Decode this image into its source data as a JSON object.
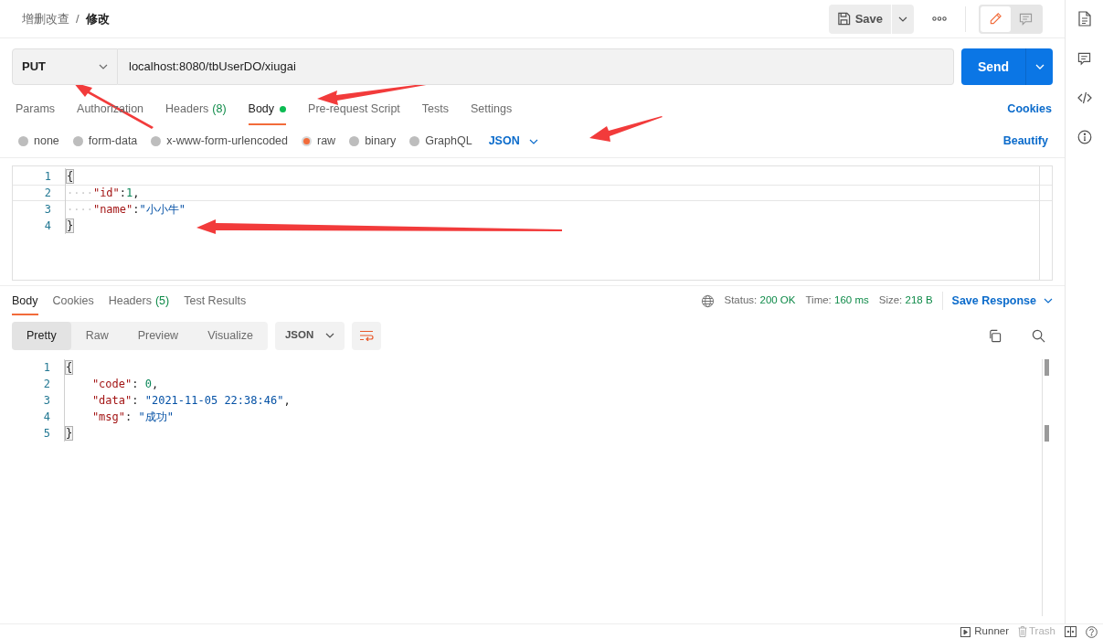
{
  "breadcrumb": {
    "parent": "增删改查",
    "separator": "/",
    "current": "修改"
  },
  "header_actions": {
    "save": "Save",
    "edit_mode_selected": true
  },
  "request": {
    "method": "PUT",
    "url": "localhost:8080/tbUserDO/xiugai",
    "send": "Send"
  },
  "request_tabs": [
    {
      "label": "Params",
      "selected": false
    },
    {
      "label": "Authorization",
      "selected": false
    },
    {
      "label": "Headers",
      "count": "(8)",
      "selected": false
    },
    {
      "label": "Body",
      "dot": true,
      "selected": true
    },
    {
      "label": "Pre-request Script",
      "selected": false
    },
    {
      "label": "Tests",
      "selected": false
    },
    {
      "label": "Settings",
      "selected": false
    }
  ],
  "cookies_link": "Cookies",
  "body_types": [
    {
      "label": "none",
      "selected": false
    },
    {
      "label": "form-data",
      "selected": false
    },
    {
      "label": "x-www-form-urlencoded",
      "selected": false
    },
    {
      "label": "raw",
      "selected": true
    },
    {
      "label": "binary",
      "selected": false
    },
    {
      "label": "GraphQL",
      "selected": false
    }
  ],
  "body_format": "JSON",
  "beautify": "Beautify",
  "request_body": [
    {
      "number": "1",
      "tokens": [
        {
          "kind": "brace",
          "text": "{"
        }
      ]
    },
    {
      "number": "2",
      "tokens": [
        {
          "kind": "ws",
          "text": "····"
        },
        {
          "kind": "key",
          "text": "\"id\""
        },
        {
          "kind": "punct",
          "text": ":"
        },
        {
          "kind": "number",
          "text": "1"
        },
        {
          "kind": "punct",
          "text": ","
        }
      ]
    },
    {
      "number": "3",
      "tokens": [
        {
          "kind": "ws",
          "text": "····"
        },
        {
          "kind": "key",
          "text": "\"name\""
        },
        {
          "kind": "punct",
          "text": ":"
        },
        {
          "kind": "string",
          "text": "\"小小牛\""
        }
      ]
    },
    {
      "number": "4",
      "tokens": [
        {
          "kind": "brace",
          "text": "}"
        }
      ]
    }
  ],
  "response_tabs": [
    {
      "label": "Body",
      "selected": true
    },
    {
      "label": "Cookies",
      "selected": false
    },
    {
      "label": "Headers",
      "count": "(5)",
      "selected": false
    },
    {
      "label": "Test Results",
      "selected": false
    }
  ],
  "response_meta": [
    {
      "label": "Status:",
      "value": "200 OK"
    },
    {
      "label": "Time:",
      "value": "160 ms"
    },
    {
      "label": "Size:",
      "value": "218 B"
    }
  ],
  "save_response": "Save Response",
  "view_modes": [
    {
      "label": "Pretty",
      "selected": true
    },
    {
      "label": "Raw",
      "selected": false
    },
    {
      "label": "Preview",
      "selected": false
    },
    {
      "label": "Visualize",
      "selected": false
    }
  ],
  "response_format": "JSON",
  "response_body": [
    {
      "number": "1",
      "tokens": [
        {
          "kind": "brace",
          "text": "{"
        }
      ]
    },
    {
      "number": "2",
      "tokens": [
        {
          "kind": "key",
          "text": "    \"code\""
        },
        {
          "kind": "punct",
          "text": ": "
        },
        {
          "kind": "number",
          "text": "0"
        },
        {
          "kind": "punct",
          "text": ","
        }
      ]
    },
    {
      "number": "3",
      "tokens": [
        {
          "kind": "key",
          "text": "    \"data\""
        },
        {
          "kind": "punct",
          "text": ": "
        },
        {
          "kind": "string",
          "text": "\"2021-11-05 22:38:46\""
        },
        {
          "kind": "punct",
          "text": ","
        }
      ]
    },
    {
      "number": "4",
      "tokens": [
        {
          "kind": "key",
          "text": "    \"msg\""
        },
        {
          "kind": "punct",
          "text": ": "
        },
        {
          "kind": "string",
          "text": "\"成功\""
        }
      ]
    },
    {
      "number": "5",
      "tokens": [
        {
          "kind": "brace",
          "text": "}"
        }
      ]
    }
  ],
  "footer": {
    "runner": "Runner",
    "trash": "Trash"
  }
}
